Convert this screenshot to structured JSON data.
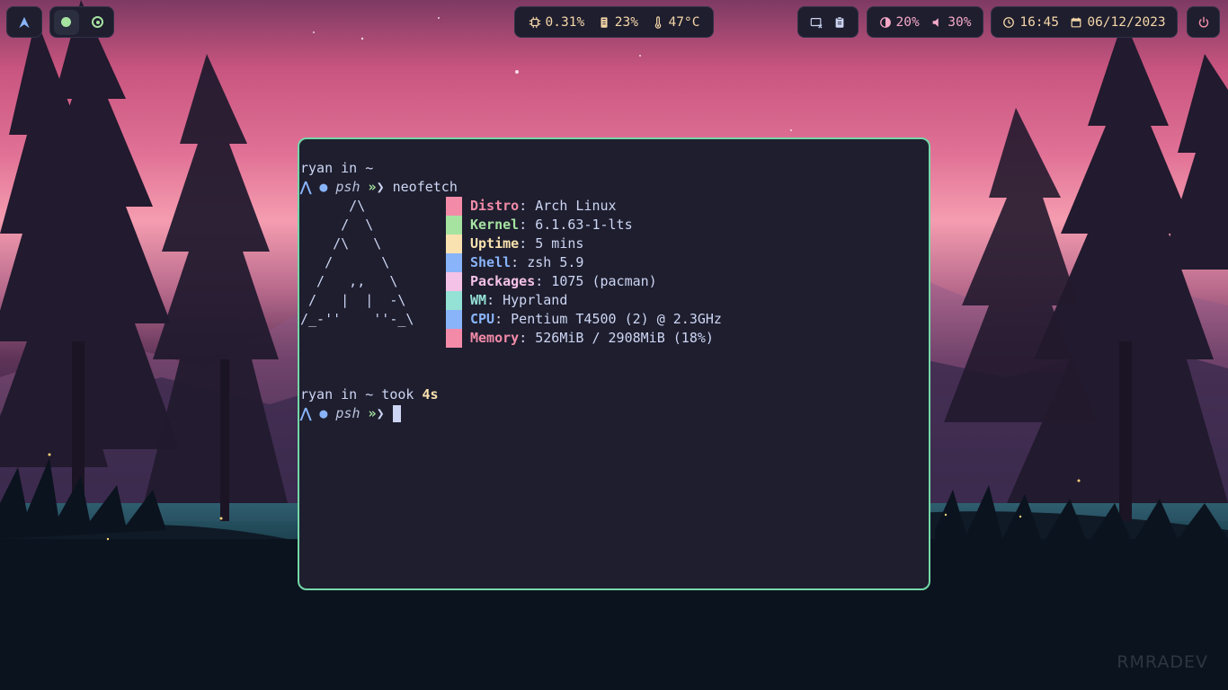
{
  "bar": {
    "workspaces": [
      {
        "state": "active",
        "icon": "filled-dot-icon"
      },
      {
        "state": "inactive",
        "icon": "target-ring-icon"
      }
    ],
    "cpu": "0.31%",
    "memory": "23%",
    "temperature": "47°C",
    "brightness": "20%",
    "volume": "30%",
    "time": "16:45",
    "date": "06/12/2023"
  },
  "terminal": {
    "line1_user": "ryan",
    "line1_in": " in ",
    "line1_dir": "~",
    "prompt_name": "psh",
    "command": "neofetch",
    "ascii": "      /\\\n     /  \\\n    /\\   \\\n   /      \\\n  /   ,,   \\\n /   |  |  -\\\n/_-''    ''-_\\",
    "info": [
      {
        "key": "Distro",
        "value": ": Arch Linux",
        "color": "#f38ba8"
      },
      {
        "key": "Kernel",
        "value": ": 6.1.63-1-lts",
        "color": "#a6e3a1"
      },
      {
        "key": "Uptime",
        "value": ": 5 mins",
        "color": "#f9e2af"
      },
      {
        "key": "Shell",
        "value": ": zsh 5.9",
        "color": "#89b4fa"
      },
      {
        "key": "Packages",
        "value": ": 1075 (pacman)",
        "color": "#f5c2e7"
      },
      {
        "key": "WM",
        "value": ": Hyprland",
        "color": "#94e2d5"
      },
      {
        "key": "CPU",
        "value": ": Pentium T4500 (2) @ 2.3GHz",
        "color": "#89b4fa"
      },
      {
        "key": "Memory",
        "value": ": 526MiB / 2908MiB (18%)",
        "color": "#f38ba8"
      }
    ],
    "line2_user": "ryan",
    "line2_in": " in ",
    "line2_dir": "~",
    "line2_took": " took ",
    "line2_duration": "4s"
  },
  "watermark": "RMRADEV",
  "colors": {
    "accent": "#74d7a8",
    "bar_bg": "#1e1e2e",
    "bar_text": "#f5d6a8",
    "media_text": "#f5a8c8",
    "power": "#f38ba8"
  }
}
